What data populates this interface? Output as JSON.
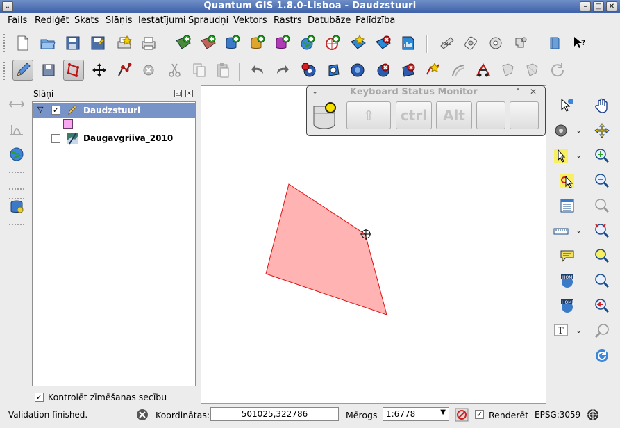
{
  "window": {
    "title": "Quantum GIS 1.8.0-Lisboa - Daudzstuuri",
    "menu_icon": "chevron-down-icon",
    "minimize_glyph": "–",
    "maximize_glyph": "□",
    "close_glyph": "✕"
  },
  "menu": [
    {
      "pre": "",
      "u": "F",
      "post": "ails"
    },
    {
      "pre": "",
      "u": "R",
      "post": "ediģēt"
    },
    {
      "pre": "",
      "u": "S",
      "post": "kats"
    },
    {
      "pre": "S",
      "u": "l",
      "post": "āņis"
    },
    {
      "pre": "",
      "u": "I",
      "post": "estatījumi"
    },
    {
      "pre": "S",
      "u": "p",
      "post": "raudņi"
    },
    {
      "pre": "Vek",
      "u": "t",
      "post": "ors"
    },
    {
      "pre": "",
      "u": "R",
      "post": "astrs"
    },
    {
      "pre": "",
      "u": "D",
      "post": "atubāze"
    },
    {
      "pre": "",
      "u": "P",
      "post": "alīdzība"
    }
  ],
  "layers_panel": {
    "title": "Slāņi",
    "float_glyph": "◱",
    "close_glyph": "✕",
    "layers": [
      {
        "name": "Daudzstuuri",
        "checked": true,
        "selected": true,
        "expanded": true,
        "swatch": "#f7a8f0"
      },
      {
        "name": "Daugavgriiva_2010",
        "checked": false,
        "selected": false
      }
    ],
    "render_order_label": "Kontrolēt zīmēšanas secību",
    "render_order_checked": true
  },
  "keyboard_monitor": {
    "title": "Keyboard Status Monitor",
    "keys": [
      "⇧",
      "ctrl",
      "Alt",
      "",
      ""
    ]
  },
  "polygon": {
    "fill": "#ffb3b3",
    "stroke": "#e01010"
  },
  "statusbar": {
    "message": "Validation finished.",
    "coord_label": "Koordinātas:",
    "coord_value": "501025,322786",
    "scale_label": "Mērogs",
    "scale_value": "1:6778",
    "render_label": "Renderēt",
    "render_checked": true,
    "crs": "EPSG:3059"
  },
  "colors": {
    "title_bar": "#4a6cb0",
    "selection": "#7893c8",
    "polygon_stroke": "#e01010"
  }
}
